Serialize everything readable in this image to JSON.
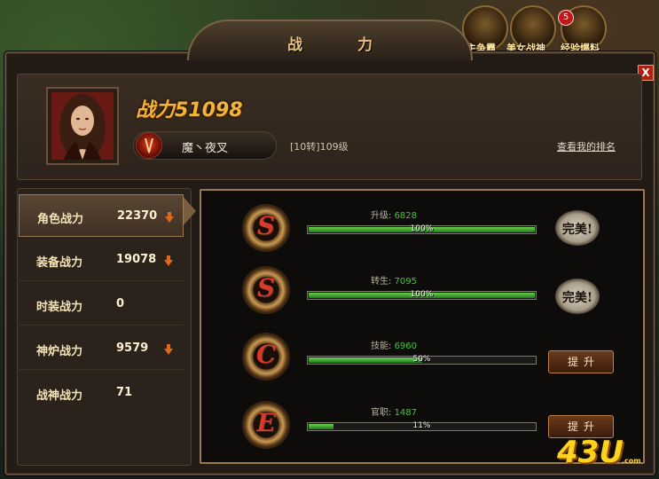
{
  "top_icons": [
    {
      "label": "霸主争霸",
      "icon": "helmet-icon"
    },
    {
      "label": "美女战神",
      "icon": "beauty-warrior-icon"
    },
    {
      "label": "经验爆料",
      "icon": "experience-icon",
      "badge": "5"
    }
  ],
  "window": {
    "title": "战 力",
    "close_label": "X"
  },
  "header": {
    "power_label": "战力51098",
    "player_name": "魔丶夜叉",
    "level": "[10转]109级",
    "rank_link": "查看我的排名"
  },
  "categories": [
    {
      "label": "角色战力",
      "value": "22370",
      "arrow": "down",
      "selected": true
    },
    {
      "label": "装备战力",
      "value": "19078",
      "arrow": "down",
      "selected": false
    },
    {
      "label": "时装战力",
      "value": "0",
      "arrow": "none",
      "selected": false
    },
    {
      "label": "神炉战力",
      "value": "9579",
      "arrow": "down",
      "selected": false
    },
    {
      "label": "战神战力",
      "value": "71",
      "arrow": "none",
      "selected": false
    }
  ],
  "stats": [
    {
      "grade": "S",
      "name": "升级:",
      "value": "6828",
      "progress": 100,
      "progress_text": "100%",
      "action": "完美!"
    },
    {
      "grade": "S",
      "name": "转生:",
      "value": "7095",
      "progress": 100,
      "progress_text": "100%",
      "action": "完美!"
    },
    {
      "grade": "C",
      "name": "技能:",
      "value": "6960",
      "progress": 50,
      "progress_text": "50%",
      "action": "提升"
    },
    {
      "grade": "E",
      "name": "官职:",
      "value": "1487",
      "progress": 11,
      "progress_text": "11%",
      "action": "提升"
    }
  ],
  "colors": {
    "accent_gold": "#f2b43a",
    "progress_green": "#46c43a",
    "arrow_orange": "#e0661a"
  },
  "logo": {
    "text": "43U",
    "sub": ".com"
  }
}
